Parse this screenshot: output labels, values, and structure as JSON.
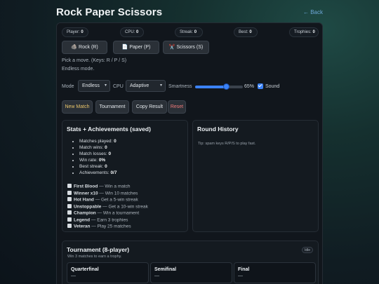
{
  "app": {
    "title": "Rock Paper Scissors",
    "back_label": "← Back"
  },
  "stats": [
    {
      "label": "Player:",
      "value": "0"
    },
    {
      "label": "CPU:",
      "value": "0"
    },
    {
      "label": "Streak:",
      "value": "0"
    },
    {
      "label": "Best:",
      "value": "0"
    },
    {
      "label": "Trophies:",
      "value": "0"
    }
  ],
  "moves": [
    {
      "icon": "🪨",
      "label": "Rock (R)"
    },
    {
      "icon": "📄",
      "label": "Paper (P)"
    },
    {
      "icon": "✂️",
      "label": "Scissors (S)"
    }
  ],
  "status": {
    "prompt": "Pick a move. (Keys: R / P / S)",
    "mode_text": "Endless mode."
  },
  "controls": {
    "mode_label": "Mode",
    "mode_value": "Endless",
    "cpu_label": "CPU",
    "cpu_value": "Adaptive",
    "smartness_label": "Smartness",
    "smartness_value": 0.65,
    "smartness_text": "65%",
    "sound_label": "Sound",
    "sound_checked": true
  },
  "actions": {
    "new_match": "New Match",
    "tournament": "Tournament",
    "copy_result": "Copy Result",
    "reset": "Reset"
  },
  "colors": {
    "new_match": "#e8c46a",
    "reset": "#ef7a7a",
    "accent": "#3b82f6"
  },
  "stats_card": {
    "title": "Stats + Achievements (saved)",
    "items": [
      {
        "label": "Matches played: ",
        "value": "0"
      },
      {
        "label": "Match wins: ",
        "value": "0"
      },
      {
        "label": "Match losses: ",
        "value": "0"
      },
      {
        "label": "Win rate: ",
        "value": "0%"
      },
      {
        "label": "Best streak: ",
        "value": "0"
      },
      {
        "label": "Achievements: ",
        "value": "0/7"
      }
    ],
    "achievements": [
      {
        "name": "First Blood",
        "desc": " — Win a match"
      },
      {
        "name": "Winner x10",
        "desc": " — Win 10 matches"
      },
      {
        "name": "Hot Hand",
        "desc": " — Get a 5-win streak"
      },
      {
        "name": "Unstoppable",
        "desc": " — Get a 10-win streak"
      },
      {
        "name": "Champion",
        "desc": " — Win a tournament"
      },
      {
        "name": "Legend",
        "desc": " — Earn 3 trophies"
      },
      {
        "name": "Veteran",
        "desc": " — Play 25 matches"
      }
    ]
  },
  "history": {
    "title": "Round History",
    "tip": "Tip: spam keys R/P/S to play fast."
  },
  "tournament": {
    "title": "Tournament (8-player)",
    "subtitle": "Win 3 matches to earn a trophy.",
    "badge": "Idle",
    "rounds": [
      {
        "name": "Quarterfinal",
        "value": "—"
      },
      {
        "name": "Semifinal",
        "value": "—"
      },
      {
        "name": "Final",
        "value": "—"
      }
    ]
  }
}
